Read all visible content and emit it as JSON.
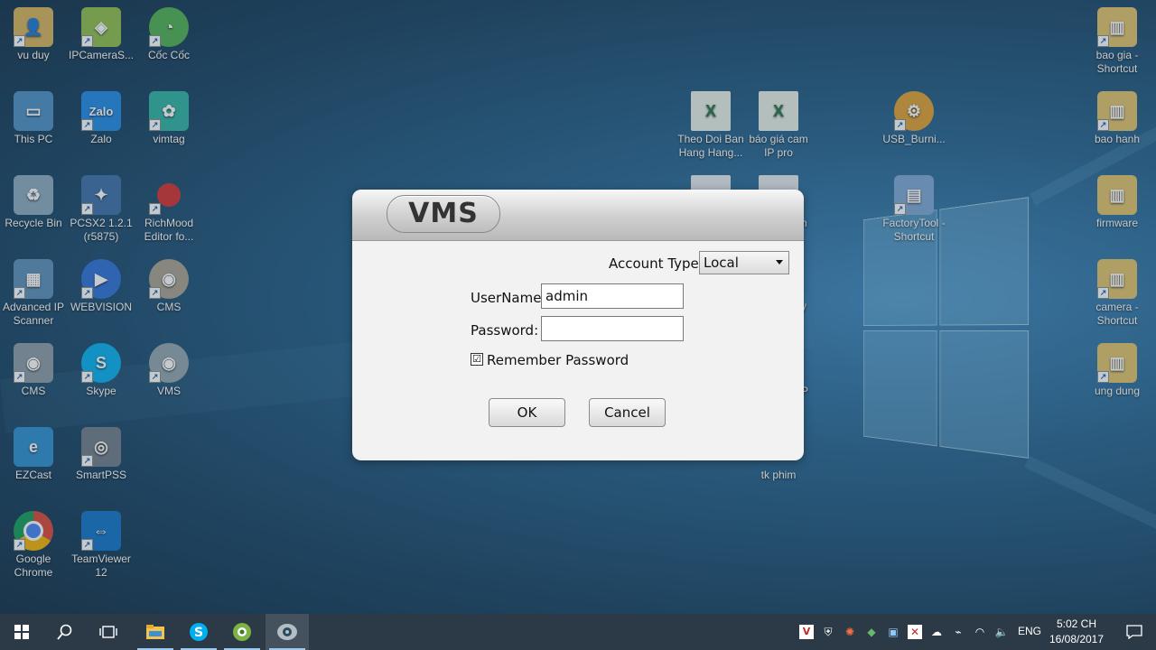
{
  "desktop": {
    "icons": [
      {
        "label": "vu duy"
      },
      {
        "label": "IPCameraS..."
      },
      {
        "label": "Cốc Cốc"
      },
      {
        "label": "This PC"
      },
      {
        "label": "Zalo"
      },
      {
        "label": "vimtag"
      },
      {
        "label": "Recycle Bin"
      },
      {
        "label": "PCSX2 1.2.1\n(r5875)"
      },
      {
        "label": "RichMood\nEditor fo..."
      },
      {
        "label": "Advanced IP\nScanner"
      },
      {
        "label": "WEBVISION"
      },
      {
        "label": "CMS"
      },
      {
        "label": "CMS"
      },
      {
        "label": "Skype"
      },
      {
        "label": "VMS"
      },
      {
        "label": "EZCast"
      },
      {
        "label": "SmartPSS"
      },
      {
        "label": "Google\nChrome"
      },
      {
        "label": "TeamViewer\n12"
      },
      {
        "label": "Theo Doi Ban\nHang Hang..."
      },
      {
        "label": "báo giá cam\nIP pro"
      },
      {
        "label": "USB_Burni..."
      },
      {
        "label": "FactoryTool -\nShortcut"
      },
      {
        "label": "tk phim"
      },
      {
        "label": "bao gia -\nShortcut"
      },
      {
        "label": "bao hanh"
      },
      {
        "label": "firmware"
      },
      {
        "label": "camera -\nShortcut"
      },
      {
        "label": "ung dung"
      }
    ],
    "partial_labels": [
      "n",
      "y",
      "P"
    ]
  },
  "dialog": {
    "logo_text": "VMS",
    "account_type_label": "Account Type:",
    "account_type_value": "Local",
    "username_label": "UserName:",
    "username_value": "admin",
    "password_label": "Password:",
    "password_value": "",
    "remember_label": "Remember Password",
    "remember_checked": "☑",
    "ok_label": "OK",
    "cancel_label": "Cancel"
  },
  "taskbar": {
    "language": "ENG",
    "time": "5:02 CH",
    "date": "16/08/2017"
  }
}
